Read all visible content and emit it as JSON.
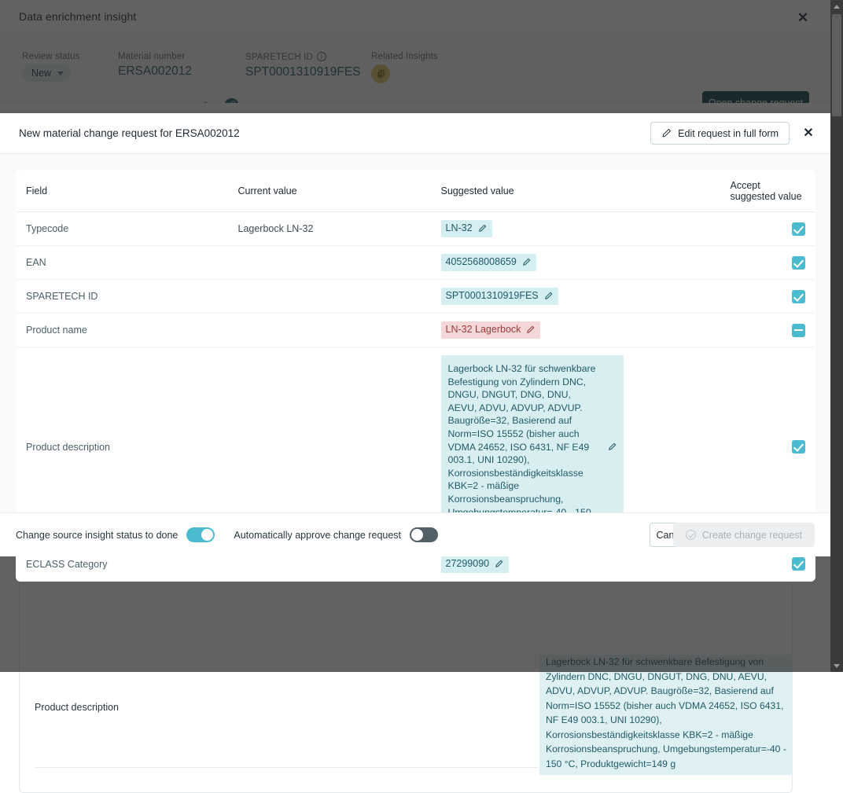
{
  "background": {
    "title": "Data enrichment insight",
    "close_icon": "close-icon",
    "meta": {
      "review_status_label": "Review status",
      "review_status_value": "New",
      "material_number_label": "Material number",
      "material_number_value": "ERSA002012",
      "sparetech_id_label": "SPARETECH ID",
      "sparetech_id_value": "SPT0001310919FES",
      "sparetech_info_icon": "info-icon",
      "link_icon": "link-icon",
      "related_insights_label": "Related Insights",
      "related_insights_icon": "document-badge-icon"
    },
    "open_change_request_label": "Open change request",
    "lower_row_label": "Product description",
    "lower_row_value": "Lagerbock LN-32 für schwenkbare Befestigung von Zylindern DNC, DNGU, DNGUT, DNG, DNU, AEVU, ADVU, ADVUP, ADVUP. Baugröße=32, Basierend auf Norm=ISO 15552 (bisher auch VDMA 24652, ISO 6431, NF E49 003.1, UNI 10290), Korrosionsbeständigkeitsklasse KBK=2 - mäßige Korrosionsbeanspruchung, Umgebungstemperatur=-40 - 150 °C, Produktgewicht=149 g"
  },
  "modal": {
    "title": "New material change request for ERSA002012",
    "edit_button_label": "Edit request in full form",
    "edit_icon": "pencil-icon",
    "close_icon": "close-icon",
    "table": {
      "headers": {
        "field": "Field",
        "current": "Current value",
        "suggested": "Suggested value",
        "accept": "Accept suggested value"
      },
      "rows": [
        {
          "field": "Typecode",
          "current": "Lagerbock LN-32",
          "suggested": "LN-32",
          "suggested_kind": "add",
          "accept": "checked"
        },
        {
          "field": "EAN",
          "current": "",
          "suggested": "4052568008659",
          "suggested_kind": "add",
          "accept": "checked"
        },
        {
          "field": "SPARETECH ID",
          "current": "",
          "suggested": "SPT0001310919FES",
          "suggested_kind": "add",
          "accept": "checked"
        },
        {
          "field": "Product name",
          "current": "",
          "suggested": "LN-32 Lagerbock",
          "suggested_kind": "del",
          "accept": "indeterminate"
        },
        {
          "field": "Product description",
          "current": "",
          "suggested": "Lagerbock LN-32 für schwenkbare Befestigung von Zylindern DNC, DNGU, DNGUT, DNG, DNU, AEVU, ADVU, ADVUP, ADVUP. Baugröße=32, Basierend auf Norm=ISO 15552 (bisher auch VDMA 24652, ISO 6431, NF E49 003.1, UNI 10290), Korrosionsbeständigkeitsklasse KBK=2 - mäßige Korrosionsbeanspruchung, Umgebungstemperatur=-40 - 150 °C, Produktgewicht=149 g",
          "suggested_kind": "block",
          "accept": "checked"
        },
        {
          "field": "ECLASS Category",
          "current": "",
          "suggested": "27299090",
          "suggested_kind": "add",
          "accept": "checked"
        }
      ]
    },
    "footer": {
      "toggle_done_label": "Change source insight status to done",
      "toggle_done_state": "on",
      "toggle_auto_label": "Automatically approve change request",
      "toggle_auto_state": "off",
      "cancel_label": "Cancel",
      "create_label": "Create change request",
      "create_icon": "circle-check-icon"
    }
  },
  "scrollbar": {
    "up_icon": "scroll-up-arrow-icon",
    "down_icon": "scroll-down-arrow-icon"
  },
  "colors": {
    "accent_teal": "#10414a",
    "chip_add_bg": "#d4eef2",
    "chip_del_bg": "#f6d7d7",
    "checkbox": "#4bbccf",
    "badge_amber": "#e0c06a"
  }
}
